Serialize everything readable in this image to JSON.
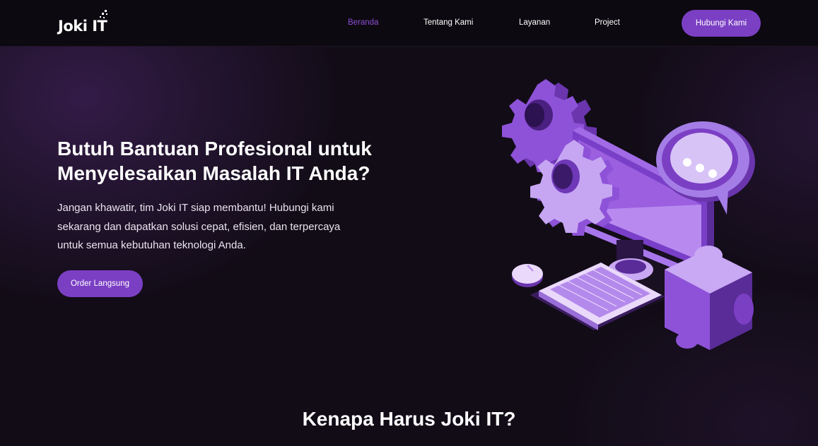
{
  "navbar": {
    "logo_text": "Joki IT",
    "links": [
      {
        "label": "Beranda",
        "active": true
      },
      {
        "label": "Tentang Kami",
        "active": false
      },
      {
        "label": "Layanan",
        "active": false
      },
      {
        "label": "Project",
        "active": false
      }
    ],
    "cta_label": "Hubungi Kami"
  },
  "hero": {
    "title_line1": "Butuh Bantuan Profesional untuk",
    "title_line2": "Menyelesaikan Masalah IT Anda?",
    "desc_line1": "Jangan khawatir, tim Joki IT siap membantu! Hubungi kami",
    "desc_line2": "sekarang dan dapatkan solusi cepat, efisien, dan terpercaya",
    "desc_line3": "untuk semua kebutuhan teknologi Anda.",
    "cta_label": "Order Langsung",
    "illustration_icons": [
      "gear-icon",
      "monitor-icon",
      "chat-bubble-icon",
      "puzzle-icon",
      "keyboard-icon",
      "mouse-icon"
    ]
  },
  "section": {
    "title": "Kenapa Harus Joki IT?"
  },
  "colors": {
    "accent": "#7b3fc4",
    "active_link": "#8c4fd6",
    "background": "#120c17",
    "navbar": "#0d0910"
  }
}
